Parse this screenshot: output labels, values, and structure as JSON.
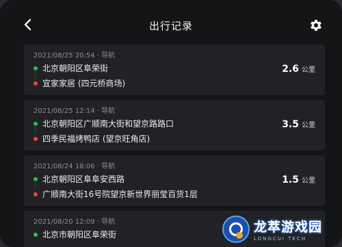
{
  "header": {
    "title": "出行记录",
    "back_icon": "chevron-left-icon",
    "settings_icon": "gear-icon"
  },
  "trips": [
    {
      "meta": "2021/08/25 20:54 · 导航",
      "from": "北京朝阳区阜荣街",
      "to": "宜家家居 (四元桥商场)",
      "distance": "2.6",
      "unit": "公里"
    },
    {
      "meta": "2021/08/25 12:14 · 导航",
      "from": "北京朝阳区广顺南大街和望京路路口",
      "to": "四季民福烤鸭店 (望京旺角店)",
      "distance": "3.5",
      "unit": "公里"
    },
    {
      "meta": "2021/08/24 18:06 · 导航",
      "from": "北京朝阳区阜阜安西路",
      "to": "广顺南大街16号院望京新世界丽莹百货1层",
      "distance": "1.5",
      "unit": "公里"
    },
    {
      "meta": "2021/08/20 12:09 · 导航",
      "from": "北京市朝阳区阜荣街"
    }
  ],
  "colors": {
    "start_dot": "#22c55e",
    "end_dot": "#ef4444",
    "card_bg": "#212225",
    "page_bg": "#141517"
  },
  "watermark": {
    "title": "龙萃游戏园",
    "subtitle": "LONGCUI TECH"
  }
}
